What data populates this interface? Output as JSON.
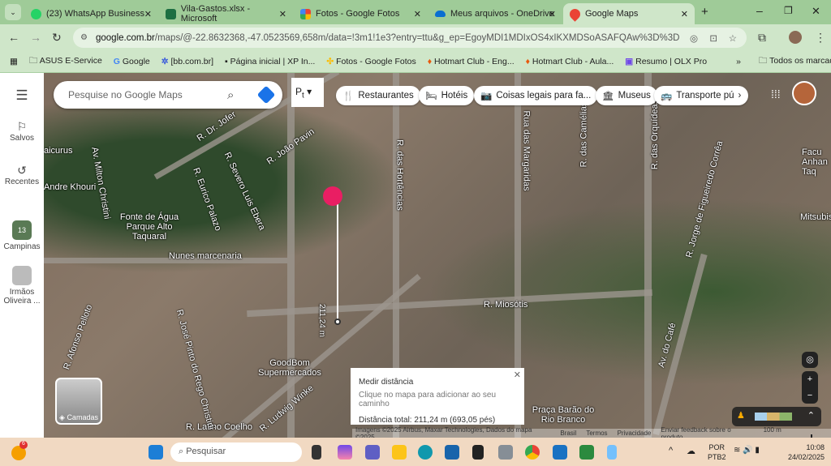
{
  "tabs": [
    {
      "label": "(23) WhatsApp Business",
      "color": "#25d366"
    },
    {
      "label": "Vila-Gastos.xlsx - Microsoft",
      "color": "#1d6f42"
    },
    {
      "label": "Fotos - Google Fotos",
      "color": "#f4b400"
    },
    {
      "label": "Meus arquivos - OneDrive",
      "color": "#0a6ed1"
    },
    {
      "label": "Google Maps",
      "color": "#ea4335",
      "active": true
    }
  ],
  "address": {
    "host": "google.com.br",
    "path": "/maps/@-22.8632368,-47.0523569,658m/data=!3m1!1e3?entry=ttu&g_ep=EgoyMDI1MDIxOS4xIKXMDSoASAFQAw%3D%3D"
  },
  "bookmarks": [
    "ASUS E-Service",
    "Google",
    "[bb.com.br]",
    "Página inicial | XP In...",
    "Fotos - Google Fotos",
    "Hotmart Club - Eng...",
    "Hotmart Club - Aula...",
    "Resumo | OLX Pro"
  ],
  "bookmarks_all": "Todos os marcadores",
  "sidebar": {
    "saved": "Salvos",
    "recent": "Recentes",
    "campinas": "Campinas",
    "irmaos": "Irmãos Oliveira ...",
    "badge": "13"
  },
  "search": {
    "placeholder": "Pesquise no Google Maps"
  },
  "chips": [
    "Restaurantes",
    "Hotéis",
    "Coisas legais para fa...",
    "Museus",
    "Transporte pú"
  ],
  "map_labels": [
    "R. Dr. Jofer",
    "R. Severo Luis Ebera",
    "R. João Pavin",
    "R. Eurico Palazo",
    "Av. Milton Christini",
    "Fonte de Água Parque Alto Taquaral",
    "Nunes marcenaria",
    "R. das Hortências",
    "Rua das Margaridas",
    "R. das Camélias",
    "R. das Orquídeas",
    "R. Jorge de Figueiredo Corrêa",
    "R. Miosótis",
    "GoodBom Supermercados",
    "R. Ludwig Winke",
    "R. Latino Coelho",
    "Av. do Café",
    "Praça Barão do Rio Branco",
    "Mitsubis",
    "Facu Anhan Taq",
    "Andre Khouri",
    "aicurus",
    "R. José Pinto do Rego Christini",
    "R. Afonso Pelloto",
    "211,24 m"
  ],
  "measure": {
    "title": "Medir distância",
    "hint": "Clique no mapa para adicionar ao seu caminho",
    "total": "Distância total: 211,24 m (693,05 pés)"
  },
  "layers": "Camadas",
  "attribution": [
    "Imagens ©2025 Airbus, Maxar Technologies, Dados do mapa ©2025",
    "Brasil",
    "Termos",
    "Privacidade",
    "Enviar feedback sobre o produto",
    "100 m"
  ],
  "taskbar": {
    "search": "Pesquisar",
    "lang1": "POR",
    "lang2": "PTB2",
    "time": "10:08",
    "date": "24/02/2025",
    "notif": "6"
  }
}
